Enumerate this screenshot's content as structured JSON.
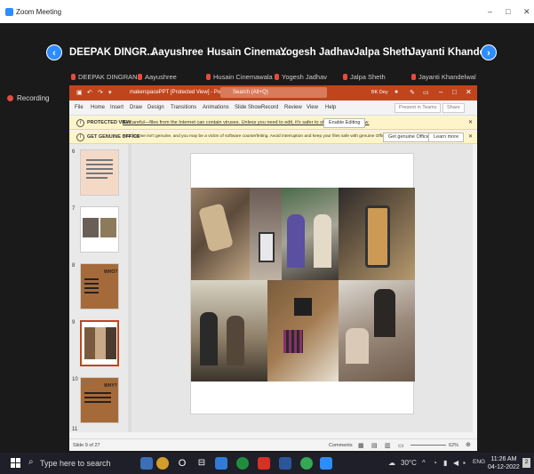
{
  "zoom": {
    "window_title": "Zoom Meeting",
    "recording_label": "Recording",
    "participants": [
      {
        "name": "DEEPAK DINGR...",
        "label": "DEEPAK DINGRANI"
      },
      {
        "name": "Aayushree",
        "label": "Aayushree"
      },
      {
        "name": "Husain Cinema...",
        "label": "Husain Cinemawala"
      },
      {
        "name": "Yogesh Jadhav",
        "label": "Yogesh Jadhav"
      },
      {
        "name": "Jalpa Sheth",
        "label": "Jalpa Sheth"
      },
      {
        "name": "Jayanti Khandel...",
        "label": "Jayanti Khandelwal"
      }
    ],
    "prev_icon": "‹",
    "next_icon": "›",
    "window_controls": {
      "minimize": "–",
      "maximize": "□",
      "close": "✕"
    }
  },
  "powerpoint": {
    "file_title": "makerspacePPT [Protected View] - PowerPoint",
    "search_placeholder": "Search (Alt+Q)",
    "user": "BK Dey",
    "ribbon_tabs": [
      "File",
      "Home",
      "Insert",
      "Draw",
      "Design",
      "Transitions",
      "Animations",
      "Slide Show",
      "Record",
      "Review",
      "View",
      "Help"
    ],
    "ribbon_buttons": {
      "present": "Present in Teams",
      "share": "Share"
    },
    "protected_view": {
      "title": "PROTECTED VIEW",
      "message": "Be careful—files from the Internet can contain viruses. Unless you need to edit, it's safer to stay in Protected View.",
      "button": "Enable Editing"
    },
    "genuine_office": {
      "title": "GET GENUINE OFFICE",
      "message": "Your license isn't genuine, and you may be a victim of software counterfeiting. Avoid interruption and keep your files safe with genuine Office today.",
      "button1": "Get genuine Office",
      "button2": "Learn more"
    },
    "thumbnails": [
      {
        "num": "6"
      },
      {
        "num": "7"
      },
      {
        "num": "8",
        "text": "WHO?"
      },
      {
        "num": "9"
      },
      {
        "num": "10",
        "text": "WHY?"
      },
      {
        "num": "11"
      }
    ],
    "status": {
      "slide": "Slide 9 of 27",
      "comments": "Comments",
      "zoom": "62%"
    }
  },
  "taskbar": {
    "search_placeholder": "Type here to search",
    "weather": "30°C",
    "lang": "ENG",
    "time": "11:26 AM",
    "date": "04-12-2022",
    "notifications": "2"
  }
}
